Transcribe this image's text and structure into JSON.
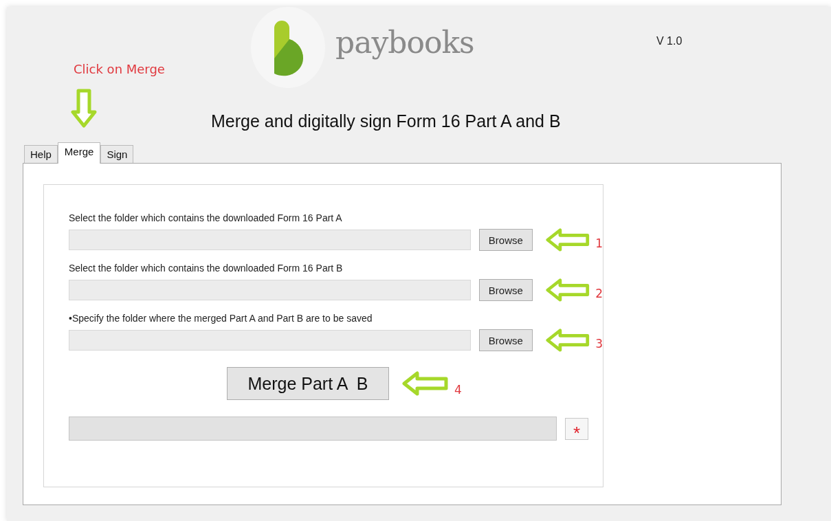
{
  "logo": {
    "wordmark": "paybooks"
  },
  "version": "V 1.0",
  "annotation": "Click on Merge",
  "title": "Merge and digitally sign Form 16 Part A and B",
  "tabs": [
    {
      "label": "Help",
      "selected": false
    },
    {
      "label": "Merge",
      "selected": true
    },
    {
      "label": "Sign",
      "selected": false
    }
  ],
  "rows": [
    {
      "label": "Select the folder which contains the downloaded Form 16 Part A",
      "button": "Browse",
      "step": "1"
    },
    {
      "label": "Select the folder which contains the downloaded Form 16 Part B",
      "button": "Browse",
      "step": "2"
    },
    {
      "label": "•Specify the folder where the merged Part A and Part B are to be saved",
      "button": "Browse",
      "step": "3"
    }
  ],
  "merge": {
    "button": "Merge Part A  B",
    "step": "4"
  },
  "star_button": "*"
}
